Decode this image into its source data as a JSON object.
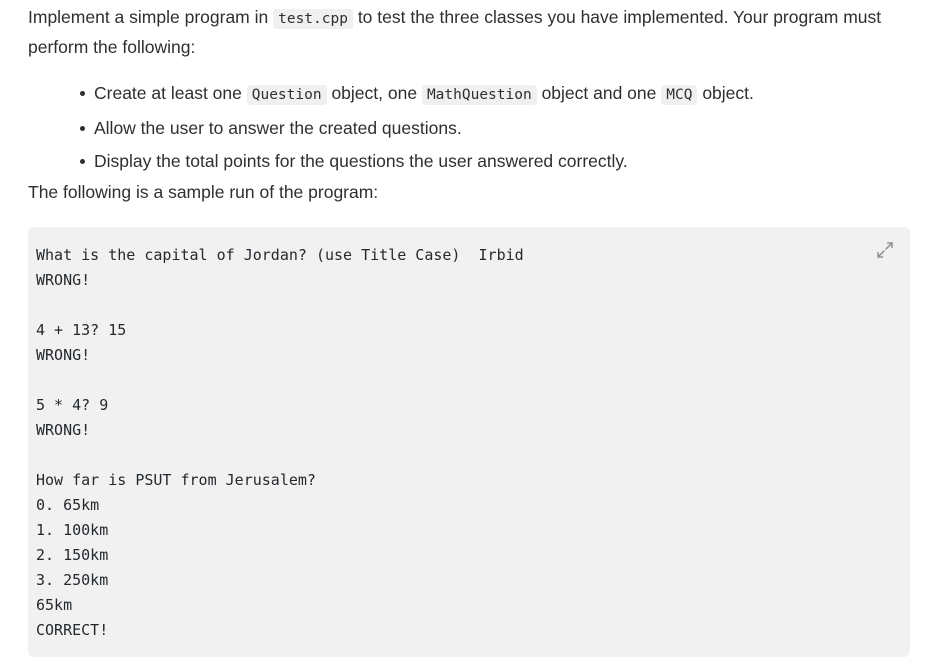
{
  "intro": {
    "part1": "Implement a simple program in ",
    "code1": "test.cpp",
    "part2": " to test the three classes you have implemented. Your program must perform the following:"
  },
  "task_list": [
    {
      "part1": "Create at least one ",
      "code1": "Question",
      "part2": " object, one ",
      "code2": "MathQuestion",
      "part3": " object and one ",
      "code3": "MCQ",
      "part4": " object."
    },
    {
      "part1": "Allow the user to answer the created questions."
    },
    {
      "part1": "Display the total points for the questions the user answered correctly."
    }
  ],
  "sample_lead": "The following is a sample run of the program:",
  "code_block": {
    "expand_icon": "expand-diagonal-arrows-icon",
    "background_color": "#f1f1f1",
    "content": "What is the capital of Jordan? (use Title Case)  Irbid\nWRONG!\n\n4 + 13? 15\nWRONG!\n\n5 * 4? 9\nWRONG!\n\nHow far is PSUT from Jerusalem?\n0. 65km\n1. 100km\n2. 150km\n3. 250km\n65km\nCORRECT!"
  }
}
